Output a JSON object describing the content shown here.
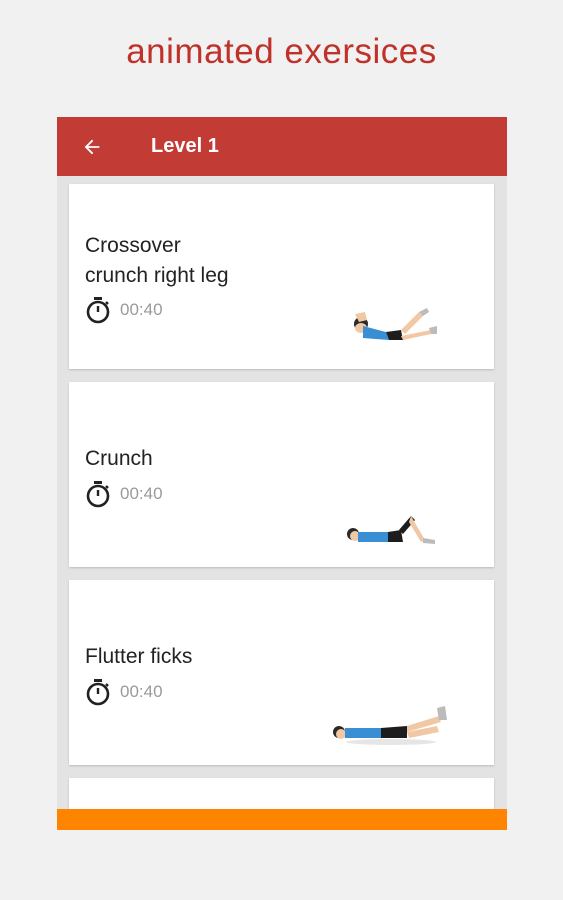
{
  "promo": {
    "title": "animated exersices"
  },
  "appbar": {
    "title": "Level 1",
    "back_icon": "arrow-left-icon"
  },
  "exercises": [
    {
      "name_line1": "Crossover",
      "name_line2": "crunch right leg",
      "duration": "00:40",
      "icon": "stopwatch-icon"
    },
    {
      "name": "Crunch",
      "duration": "00:40",
      "icon": "stopwatch-icon"
    },
    {
      "name": "Flutter ficks",
      "duration": "00:40",
      "icon": "stopwatch-icon"
    }
  ],
  "colors": {
    "accent": "#c0312a",
    "appbar": "#c23b34",
    "bottom_bar": "#ff8500",
    "card": "#ffffff",
    "background": "#f1f1f1"
  }
}
